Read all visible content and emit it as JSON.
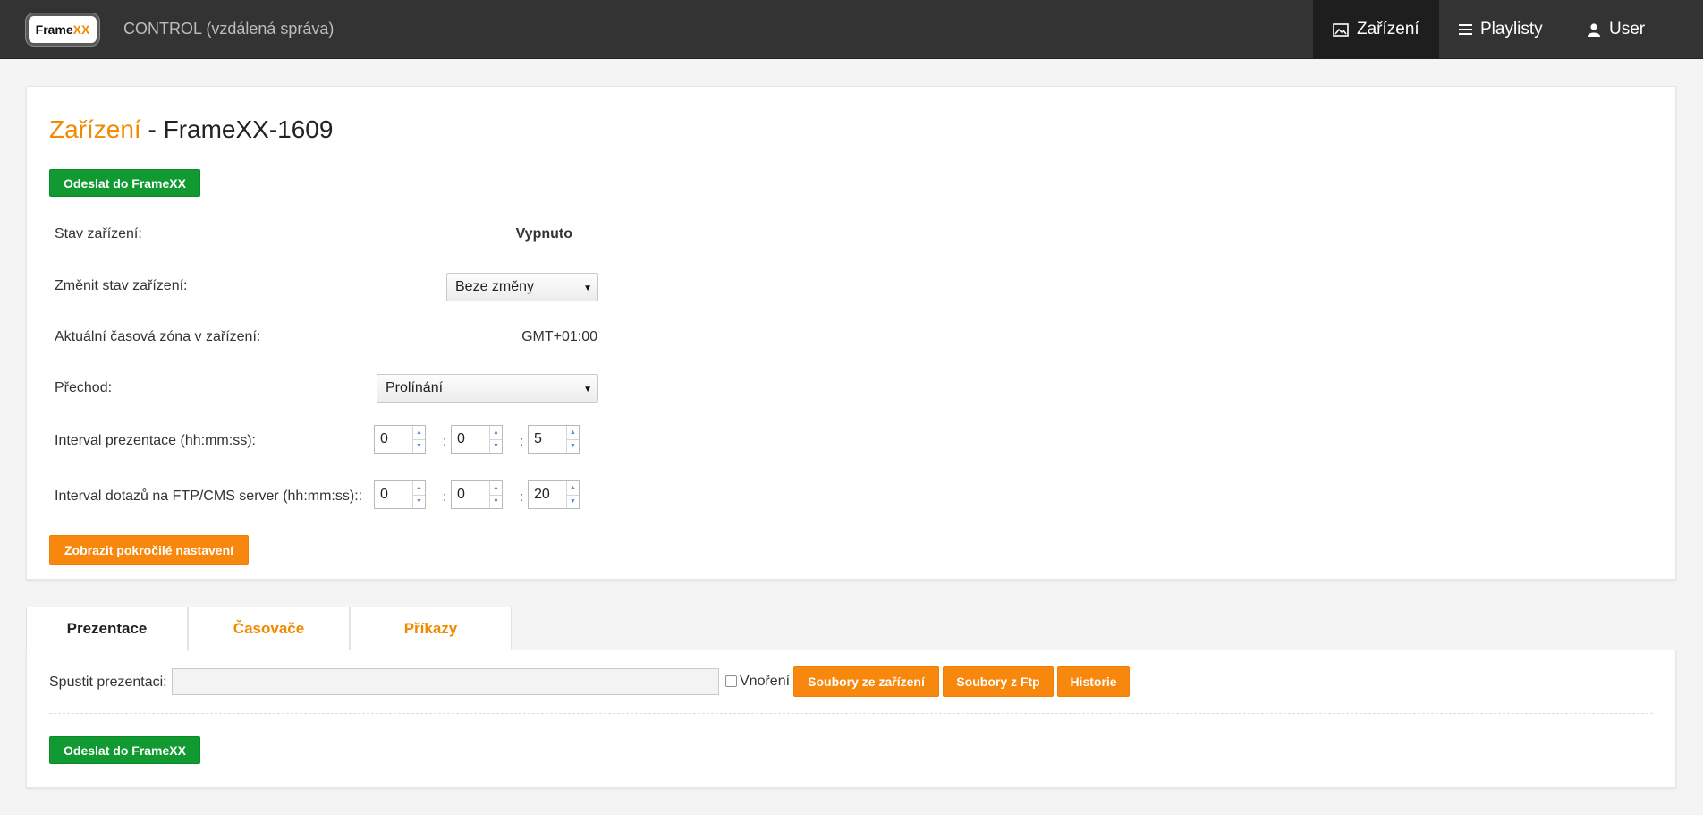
{
  "header": {
    "logo_text_a": "Frame",
    "logo_text_b": "XX",
    "app_title": "CONTROL (vzdálená správa)",
    "nav": [
      {
        "label": "Zařízení",
        "icon": "image-icon",
        "active": true
      },
      {
        "label": "Playlisty",
        "icon": "list-icon",
        "active": false
      },
      {
        "label": "User",
        "icon": "user-icon",
        "active": false
      }
    ]
  },
  "device": {
    "heading_accent": "Zařízení",
    "heading_rest": " - FrameXX-1609",
    "send_label": "Odeslat do FrameXX",
    "status_label": "Stav zařízení:",
    "status_value": "Vypnuto",
    "change_state_label": "Změnit stav zařízení:",
    "change_state_value": "Beze změny",
    "timezone_label": "Aktuální časová zóna v zařízení:",
    "timezone_value": "GMT+01:00",
    "transition_label": "Přechod:",
    "transition_value": "Prolínání",
    "interval_label": "Interval prezentace (hh:mm:ss):",
    "interval_h": "0",
    "interval_m": "0",
    "interval_s": "5",
    "ftp_interval_label": "Interval dotazů na FTP/CMS server (hh:mm:ss)::",
    "ftp_h": "0",
    "ftp_m": "0",
    "ftp_s": "20",
    "colon": ":",
    "advanced_label": "Zobrazit pokročilé nastavení"
  },
  "tabs": [
    {
      "label": "Prezentace",
      "active": true
    },
    {
      "label": "Časovače",
      "active": false
    },
    {
      "label": "Příkazy",
      "active": false
    }
  ],
  "presentation": {
    "start_label": "Spustit prezentaci:",
    "input_value": "",
    "nested_label": "Vnoření",
    "nested_checked": false,
    "files_device_label": "Soubory ze zařízení",
    "files_ftp_label": "Soubory z Ftp",
    "history_label": "Historie",
    "send_label": "Odeslat do FrameXX"
  },
  "colors": {
    "accent_orange": "#f28a00",
    "button_orange": "#f7870d",
    "button_green": "#119a32",
    "topbar": "#333333"
  }
}
